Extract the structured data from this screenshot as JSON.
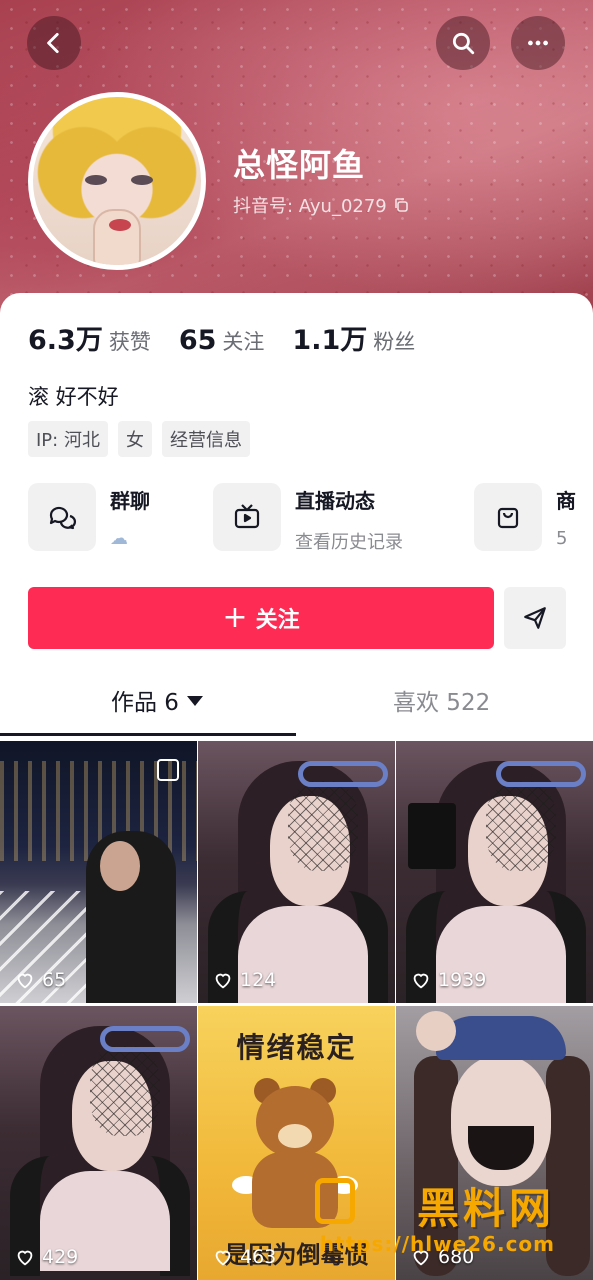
{
  "header": {
    "back_icon": "chevron-left-icon",
    "search_icon": "search-icon",
    "more_icon": "more-horizontal-icon"
  },
  "profile": {
    "nickname": "总怪阿鱼",
    "douyin_id": "抖音号: Ayu_0279"
  },
  "stats": [
    {
      "value": "6.3万",
      "label": "获赞"
    },
    {
      "value": "65",
      "label": "关注"
    },
    {
      "value": "1.1万",
      "label": "粉丝"
    }
  ],
  "bio": "滚 好不好",
  "tags": [
    "IP: 河北",
    "女",
    "经营信息"
  ],
  "features": [
    {
      "title": "群聊",
      "subtitle": "",
      "icon": "group-chat-icon"
    },
    {
      "title": "直播动态",
      "subtitle": "查看历史记录",
      "icon": "live-tv-icon"
    },
    {
      "title": "商",
      "subtitle": "5",
      "icon": "shopping-bag-icon"
    }
  ],
  "actions": {
    "follow_label": "关注",
    "share_icon": "send-icon"
  },
  "tabs": {
    "works_label": "作品 6",
    "likes_label": "喜欢 522"
  },
  "videos": [
    {
      "likes": "65"
    },
    {
      "likes": "124"
    },
    {
      "likes": "1939"
    },
    {
      "likes": "429"
    },
    {
      "likes": "463",
      "headline": "情绪稳定",
      "bottom_text": "是因为倒霉惯"
    },
    {
      "likes": "680"
    }
  ],
  "watermark": {
    "title": "黑料网",
    "url": "https://hlwe26.com"
  },
  "colors": {
    "accent": "#fe2c55",
    "watermark": "#f6a800"
  }
}
